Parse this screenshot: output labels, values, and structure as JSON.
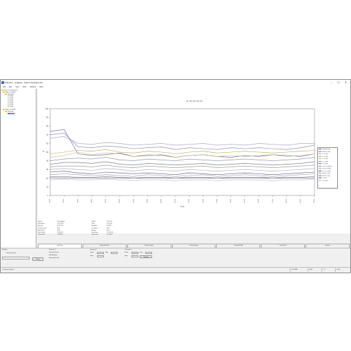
{
  "window": {
    "title": "bMonitor - Analysis - Space Sampling.bsf",
    "controls": "– ☐ ✕"
  },
  "menu": [
    "File",
    "Edit",
    "View",
    "Tools",
    "Window",
    "Help"
  ],
  "tree": {
    "root": "Space Sampling.bsf",
    "items": [
      "bMon-1 (0008)",
      "Readings",
      "T1 (101)",
      "T2 (102)",
      "T3 (103)",
      "T4 (104)",
      "T5 (105)",
      "T6 (106)",
      "bMon-2 (0009)",
      "Readings",
      "T7 (107)"
    ],
    "selected": "T7 (107)"
  },
  "chart_data": {
    "type": "line",
    "title": "T2 / T3 / T4 / T5 / T6",
    "xlabel": "Time",
    "ylabel": "°F",
    "ylim": [
      0,
      100
    ],
    "yticks": [
      0,
      10,
      20,
      30,
      40,
      50,
      60,
      70,
      80,
      90,
      100
    ],
    "categories": [
      "01:00",
      "02:00",
      "03:00",
      "04:00",
      "05:00",
      "06:00",
      "07:00",
      "08:00",
      "09:00",
      "10:00",
      "11:00",
      "12:00",
      "13:00",
      "14:00",
      "15:00",
      "16:00",
      "17:00",
      "18:00",
      "19:00",
      "20:00"
    ],
    "series": [
      {
        "name": "Lateral (FPA)",
        "color": "#5a5a8a",
        "values": [
          74,
          76,
          48,
          46,
          47,
          49,
          45,
          46,
          47,
          44,
          46,
          47,
          45,
          44,
          46,
          45,
          47,
          46,
          45,
          48
        ]
      },
      {
        "name": "Dorsal (CVA)",
        "color": "#7a7aaa",
        "values": [
          70,
          72,
          56,
          55,
          57,
          56,
          54,
          55,
          56,
          53,
          55,
          54,
          53,
          55,
          54,
          55,
          54,
          53,
          55,
          58
        ]
      },
      {
        "name": "C3 (CVA)",
        "color": "#9a9ac0",
        "values": [
          66,
          68,
          60,
          59,
          61,
          60,
          58,
          59,
          60,
          58,
          59,
          60,
          58,
          59,
          58,
          60,
          59,
          58,
          60,
          60
        ]
      },
      {
        "name": "C4 (CVA)",
        "color": "#b0a050",
        "values": [
          48,
          50,
          52,
          51,
          53,
          50,
          49,
          51,
          50,
          48,
          50,
          51,
          49,
          50,
          51,
          50,
          49,
          50,
          51,
          52
        ]
      },
      {
        "name": "L3 (CVA)",
        "color": "#c0b070",
        "values": [
          44,
          46,
          50,
          47,
          49,
          48,
          45,
          47,
          46,
          44,
          46,
          47,
          45,
          46,
          45,
          46,
          47,
          45,
          46,
          48
        ]
      },
      {
        "name": "L4 (CVA)",
        "color": "#7a8aa0",
        "values": [
          40,
          42,
          43,
          42,
          44,
          41,
          40,
          42,
          41,
          40,
          42,
          41,
          40,
          41,
          42,
          41,
          40,
          41,
          42,
          44
        ]
      },
      {
        "name": "L5 (CVA)",
        "color": "#6a6a6a",
        "values": [
          36,
          38,
          38,
          37,
          39,
          36,
          35,
          37,
          36,
          35,
          36,
          37,
          35,
          36,
          37,
          36,
          35,
          36,
          37,
          39
        ]
      },
      {
        "name": "C3/C4 (Contra)",
        "color": "#8a8a8a",
        "values": [
          33,
          34,
          34,
          33,
          35,
          33,
          32,
          34,
          33,
          32,
          33,
          34,
          32,
          33,
          34,
          33,
          32,
          33,
          34,
          35
        ]
      },
      {
        "name": "L3/L4 (Contra)",
        "color": "#a0a0b8",
        "values": [
          30,
          31,
          30,
          29,
          31,
          30,
          28,
          30,
          29,
          28,
          30,
          29,
          28,
          29,
          30,
          29,
          28,
          29,
          30,
          31
        ]
      },
      {
        "name": "L4/L5 (Contra)",
        "color": "#4a4a7a",
        "values": [
          27,
          28,
          26,
          25,
          27,
          26,
          25,
          26,
          25,
          24,
          26,
          25,
          24,
          25,
          26,
          25,
          24,
          25,
          26,
          27
        ]
      },
      {
        "name": "Flexor (CVA)",
        "color": "#9090a0",
        "values": [
          24,
          25,
          24,
          23,
          24,
          23,
          22,
          24,
          23,
          22,
          23,
          24,
          22,
          23,
          24,
          23,
          22,
          23,
          24,
          25
        ]
      },
      {
        "name": "Flexor (CVA)",
        "color": "#707088",
        "values": [
          22,
          22,
          21,
          21,
          22,
          21,
          20,
          21,
          21,
          20,
          21,
          21,
          20,
          21,
          21,
          21,
          20,
          21,
          21,
          22
        ]
      },
      {
        "name": "Control",
        "color": "#505060",
        "values": [
          20,
          20,
          20,
          20,
          20,
          20,
          20,
          20,
          20,
          20,
          20,
          20,
          20,
          20,
          20,
          20,
          20,
          20,
          20,
          20
        ]
      },
      {
        "name": "C4 (CVA)",
        "color": "#b8b8c8",
        "values": [
          18,
          19,
          18,
          18,
          19,
          18,
          17,
          18,
          18,
          17,
          18,
          18,
          17,
          18,
          18,
          18,
          17,
          18,
          18,
          19
        ]
      }
    ],
    "legend": "right",
    "grid": false
  },
  "stats": {
    "rows": [
      [
        "Series",
        "Description",
        "Delay",
        "12.3 sec"
      ],
      [
        "Start time",
        "1/1 01:00",
        "Time",
        "13.0 sec"
      ],
      [
        "Interval",
        "00:10:00",
        "Samples",
        "0.0000"
      ],
      [
        "Hi Value (°F)",
        "98.7",
        "Lo Value",
        "18.2"
      ],
      [
        "Mean (°F)",
        "48.2",
        "Range",
        "80.5"
      ],
      [
        "Time Span",
        "19:00:00",
        "Stop time",
        "1/1 20:00"
      ],
      [
        "Start Date",
        "1/1/2012",
        "Stop Date",
        "1/1/2012"
      ]
    ]
  },
  "tabs": [
    "Full Log",
    "Selected Data",
    "Sliced Graph",
    "Count Graph",
    "Contrast FRF",
    "Count Dist",
    "Events"
  ],
  "activeTab": "Full Log",
  "controls": {
    "display_label": "Display",
    "opt1": "Channel Scale",
    "opt2": "Full Window",
    "opt3": "Selected Scale",
    "channel1_label": "Channel 1",
    "channel2_label": "Channel 2",
    "from_label": "From",
    "to_label": "Size",
    "step_label": "Step",
    "field1": "",
    "field2": "",
    "btn1": "Graph",
    "btn2": "Update"
  },
  "status": {
    "left": "Loading complete",
    "cells": [
      "10:00 AM",
      "NUM",
      "1 / 1",
      "100%"
    ]
  }
}
